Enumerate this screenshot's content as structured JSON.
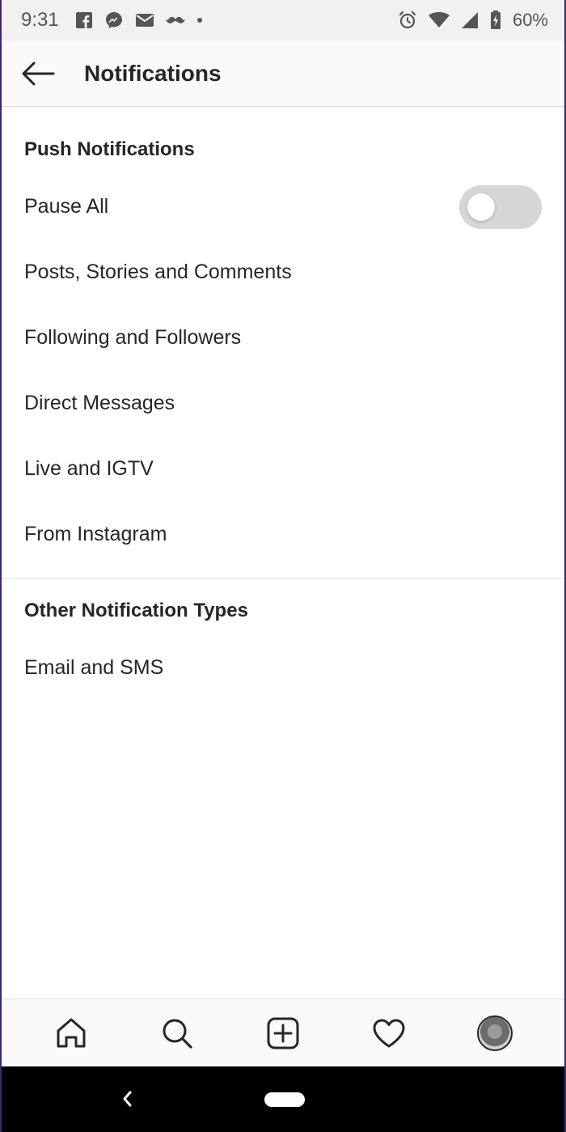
{
  "status_bar": {
    "time": "9:31",
    "battery": "60%",
    "left_icons": [
      "facebook-icon",
      "messenger-icon",
      "mail-icon",
      "mustache-icon",
      "dot-icon"
    ],
    "right_icons": [
      "alarm-icon",
      "wifi-icon",
      "signal-icon",
      "battery-charging-icon"
    ]
  },
  "app_bar": {
    "title": "Notifications",
    "back_icon": "arrow-left-icon"
  },
  "sections": [
    {
      "title": "Push Notifications",
      "items": [
        {
          "label": "Pause All",
          "toggle": false
        },
        {
          "label": "Posts, Stories and Comments"
        },
        {
          "label": "Following and Followers"
        },
        {
          "label": "Direct Messages"
        },
        {
          "label": "Live and IGTV"
        },
        {
          "label": "From Instagram"
        }
      ]
    },
    {
      "title": "Other Notification Types",
      "items": [
        {
          "label": "Email and SMS"
        }
      ]
    }
  ],
  "bottom_nav": [
    "home-icon",
    "search-icon",
    "add-post-icon",
    "heart-icon",
    "profile-avatar"
  ],
  "colors": {
    "text": "#262626",
    "toggle_off": "#d6d6d6",
    "status_bar_bg": "#f1f1f1",
    "system_nav_bg": "#000000"
  }
}
